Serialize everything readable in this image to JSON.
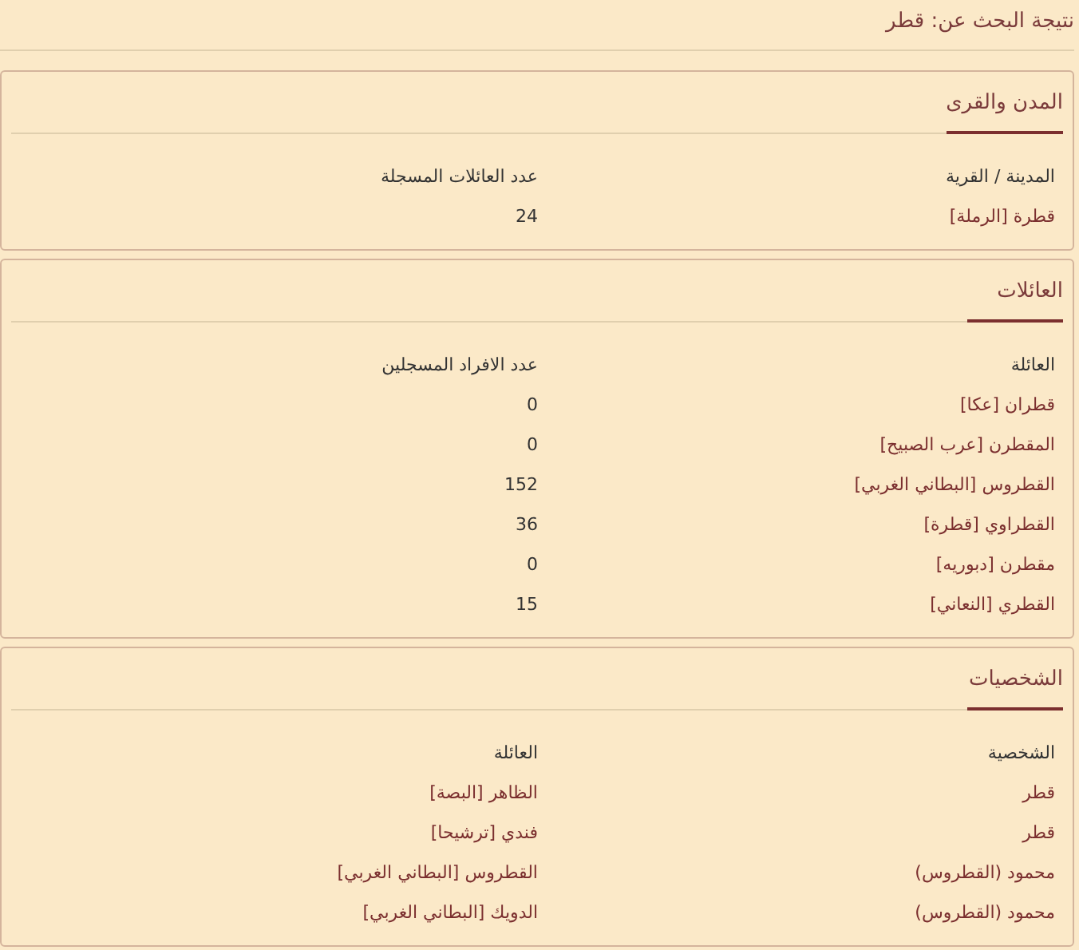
{
  "heading": "نتيجة البحث عن: قطر",
  "sections": [
    {
      "title": "المدن والقرى",
      "columns": [
        "المدينة / القرية",
        "عدد العائلات المسجلة"
      ],
      "rows": [
        {
          "cells": [
            {
              "text": "قطرة   [الرملة]",
              "link": true
            },
            {
              "text": "24",
              "link": false
            }
          ]
        }
      ]
    },
    {
      "title": "العائلات",
      "columns": [
        "العائلة",
        "عدد الافراد المسجلين"
      ],
      "rows": [
        {
          "cells": [
            {
              "text": "قطران [عكا]",
              "link": true
            },
            {
              "text": "0",
              "link": false
            }
          ]
        },
        {
          "cells": [
            {
              "text": "المقطرن [عرب الصبيح]",
              "link": true
            },
            {
              "text": "0",
              "link": false
            }
          ]
        },
        {
          "cells": [
            {
              "text": "القطروس [البطاني الغربي]",
              "link": true
            },
            {
              "text": "152",
              "link": false
            }
          ]
        },
        {
          "cells": [
            {
              "text": "القطراوي [قطرة]",
              "link": true
            },
            {
              "text": "36",
              "link": false
            }
          ]
        },
        {
          "cells": [
            {
              "text": "مقطرن [دبوريه]",
              "link": true
            },
            {
              "text": "0",
              "link": false
            }
          ]
        },
        {
          "cells": [
            {
              "text": "القطري [النعاني]",
              "link": true
            },
            {
              "text": "15",
              "link": false
            }
          ]
        }
      ]
    },
    {
      "title": "الشخصيات",
      "columns": [
        "الشخصية",
        "العائلة"
      ],
      "rows": [
        {
          "cells": [
            {
              "text": "قطر",
              "link": true
            },
            {
              "text": "الظاهر [البصة]",
              "link": true
            }
          ]
        },
        {
          "cells": [
            {
              "text": "قطر",
              "link": true
            },
            {
              "text": "فندي [ترشيحا]",
              "link": true
            }
          ]
        },
        {
          "cells": [
            {
              "text": "محمود (القطروس)",
              "link": true
            },
            {
              "text": "القطروس [البطاني الغربي]",
              "link": true
            }
          ]
        },
        {
          "cells": [
            {
              "text": "محمود (القطروس)",
              "link": true
            },
            {
              "text": "الدويك [البطاني الغربي]",
              "link": true
            }
          ]
        }
      ]
    }
  ]
}
